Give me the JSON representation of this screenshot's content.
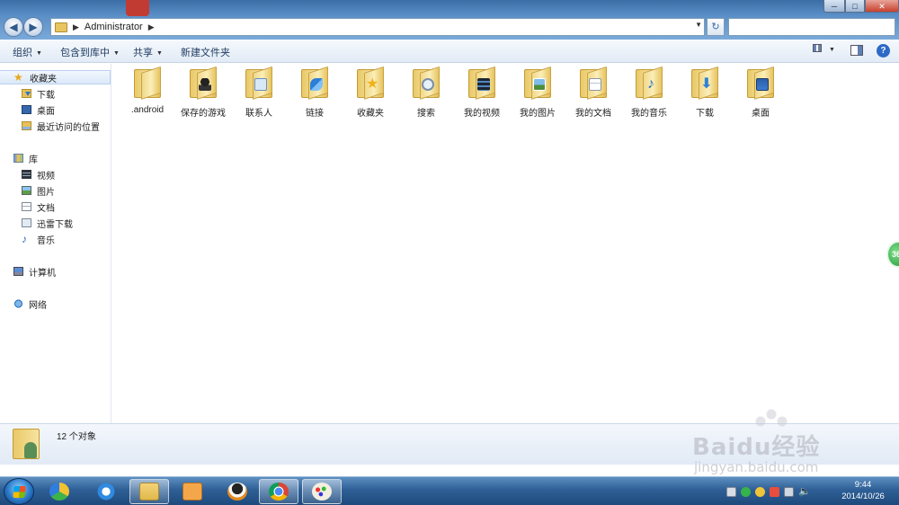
{
  "window": {
    "address": {
      "path_segments": [
        "Administrator"
      ]
    },
    "search": {
      "value": "",
      "placeholder": ""
    },
    "buttons": {
      "minimize": "─",
      "maximize": "□",
      "close": "✕",
      "refresh": "↻"
    }
  },
  "toolbar": {
    "organize": "组织",
    "include_in_library": "包含到库中",
    "share": "共享",
    "new_folder": "新建文件夹",
    "help": "?"
  },
  "navigation": {
    "favorites": {
      "label": "收藏夹",
      "items": [
        "下载",
        "桌面",
        "最近访问的位置"
      ]
    },
    "libraries": {
      "label": "库",
      "items": [
        "视频",
        "图片",
        "文档",
        "迅雷下载",
        "音乐"
      ]
    },
    "computer": "计算机",
    "network": "网络"
  },
  "folders": [
    {
      "label": ".android",
      "icon": "folder-icon"
    },
    {
      "label": "保存的游戏",
      "icon": "saved-games-folder-icon"
    },
    {
      "label": "联系人",
      "icon": "contacts-folder-icon"
    },
    {
      "label": "链接",
      "icon": "links-folder-icon"
    },
    {
      "label": "收藏夹",
      "icon": "favorites-folder-icon"
    },
    {
      "label": "搜索",
      "icon": "searches-folder-icon"
    },
    {
      "label": "我的视频",
      "icon": "videos-folder-icon"
    },
    {
      "label": "我的图片",
      "icon": "pictures-folder-icon"
    },
    {
      "label": "我的文档",
      "icon": "documents-folder-icon"
    },
    {
      "label": "我的音乐",
      "icon": "music-folder-icon"
    },
    {
      "label": "下载",
      "icon": "downloads-folder-icon"
    },
    {
      "label": "桌面",
      "icon": "desktop-folder-icon"
    }
  ],
  "details": {
    "item_count": "12 个对象"
  },
  "taskbar": {
    "apps": [
      "start-button",
      "360-safe-icon",
      "internet-explorer-icon",
      "file-explorer-icon",
      "media-player-icon",
      "qq-icon",
      "chrome-icon",
      "paint-icon"
    ],
    "clock": {
      "time": "9:44",
      "date": "2014/10/26"
    }
  },
  "overlay": {
    "side_float": "36",
    "watermark": {
      "brand": "Baidu经验",
      "url": "jingyan.baidu.com"
    }
  },
  "colors": {
    "accent": "#3b6ea5",
    "taskbar": "#2e5f96",
    "folder": "#e9c968"
  }
}
